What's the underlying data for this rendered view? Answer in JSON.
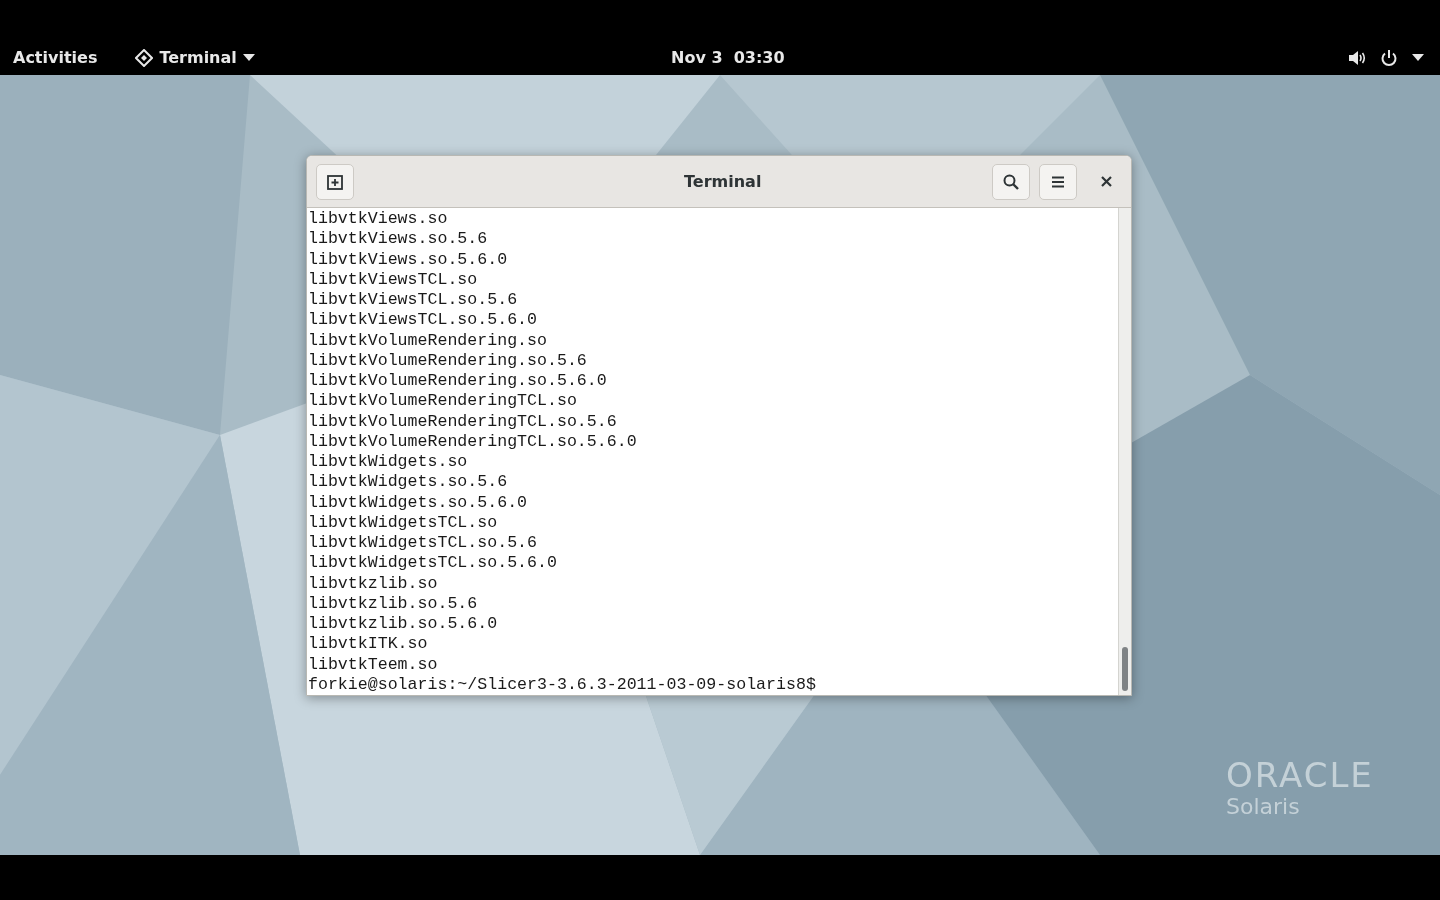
{
  "top_bar": {
    "activities": "Activities",
    "app_menu": "Terminal",
    "clock": "Nov 3  03:30"
  },
  "desktop": {
    "logo": {
      "line_1": "ORACLE",
      "line_2": "Solaris"
    }
  },
  "window": {
    "title": "Terminal",
    "lines": [
      "libvtkViews.so",
      "libvtkViews.so.5.6",
      "libvtkViews.so.5.6.0",
      "libvtkViewsTCL.so",
      "libvtkViewsTCL.so.5.6",
      "libvtkViewsTCL.so.5.6.0",
      "libvtkVolumeRendering.so",
      "libvtkVolumeRendering.so.5.6",
      "libvtkVolumeRendering.so.5.6.0",
      "libvtkVolumeRenderingTCL.so",
      "libvtkVolumeRenderingTCL.so.5.6",
      "libvtkVolumeRenderingTCL.so.5.6.0",
      "libvtkWidgets.so",
      "libvtkWidgets.so.5.6",
      "libvtkWidgets.so.5.6.0",
      "libvtkWidgetsTCL.so",
      "libvtkWidgetsTCL.so.5.6",
      "libvtkWidgetsTCL.so.5.6.0",
      "libvtkzlib.so",
      "libvtkzlib.so.5.6",
      "libvtkzlib.so.5.6.0",
      "libvtkITK.so",
      "libvtkTeem.so"
    ],
    "prompt": "forkie@solaris:~/Slicer3-3.6.3-2011-03-09-solaris8$"
  }
}
